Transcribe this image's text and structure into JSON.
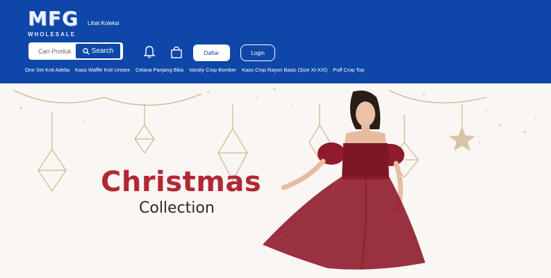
{
  "header": {
    "logo_text": "MFG",
    "logo_subtext": "WHOLESALE",
    "collection_link": "Lihat Koleksi",
    "search": {
      "placeholder": "Cari Produk",
      "button_label": "Search"
    },
    "icons": [
      "bell-icon",
      "shopping-bag-icon",
      "search-icon"
    ],
    "register_label": "Daftar",
    "login_label": "Login"
  },
  "categories": [
    "One Set Knit Adelia",
    "Kaos Waffle Knit Unisex",
    "Celana Panjang Bika",
    "Varsity Crop Bomber",
    "Kaos Crop Rayon Basic (Size XI-XXI)",
    "Puff Crop Top"
  ],
  "banner": {
    "title": "Christmas",
    "subtitle": "Collection"
  },
  "colors": {
    "header_bg": "#0f47a8",
    "title_red": "#b22834",
    "dress": "#8e1c2c",
    "gold_ornaments": "#c9a676"
  }
}
